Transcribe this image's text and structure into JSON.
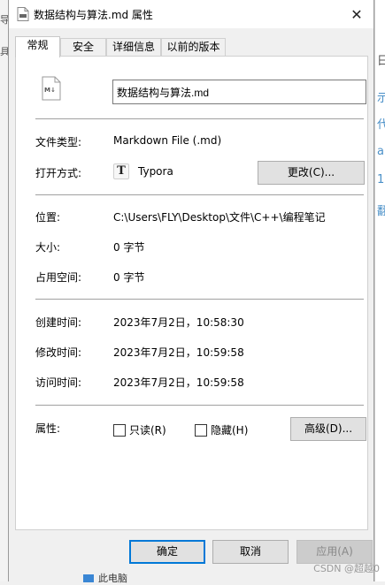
{
  "window": {
    "title": "数据结构与算法.md 属性"
  },
  "tabs": [
    {
      "label": "常规"
    },
    {
      "label": "安全"
    },
    {
      "label": "详细信息"
    },
    {
      "label": "以前的版本"
    }
  ],
  "general": {
    "filename": "数据结构与算法.md",
    "file_type_label": "文件类型:",
    "file_type_value": "Markdown File (.md)",
    "open_with_label": "打开方式:",
    "open_with_value": "Typora",
    "change_button": "更改(C)...",
    "location_label": "位置:",
    "location_value": "C:\\Users\\FLY\\Desktop\\文件\\C++\\编程笔记",
    "size_label": "大小:",
    "size_value": "0 字节",
    "size_on_disk_label": "占用空间:",
    "size_on_disk_value": "0 字节",
    "created_label": "创建时间:",
    "created_value": "2023年7月2日，10:58:30",
    "modified_label": "修改时间:",
    "modified_value": "2023年7月2日，10:59:58",
    "accessed_label": "访问时间:",
    "accessed_value": "2023年7月2日，10:59:58",
    "attributes_label": "属性:",
    "readonly_label": "只读(R)",
    "hidden_label": "隐藏(H)",
    "advanced_button": "高级(D)..."
  },
  "footer": {
    "ok": "确定",
    "cancel": "取消",
    "apply": "应用(A)"
  },
  "background": {
    "left_glyphs": [
      "导",
      "具"
    ],
    "right_glyphs": [
      "日",
      "示",
      "代",
      "a",
      "1",
      "翻"
    ],
    "bottom_text": "此电脑"
  },
  "watermark": "CSDN @超越0"
}
